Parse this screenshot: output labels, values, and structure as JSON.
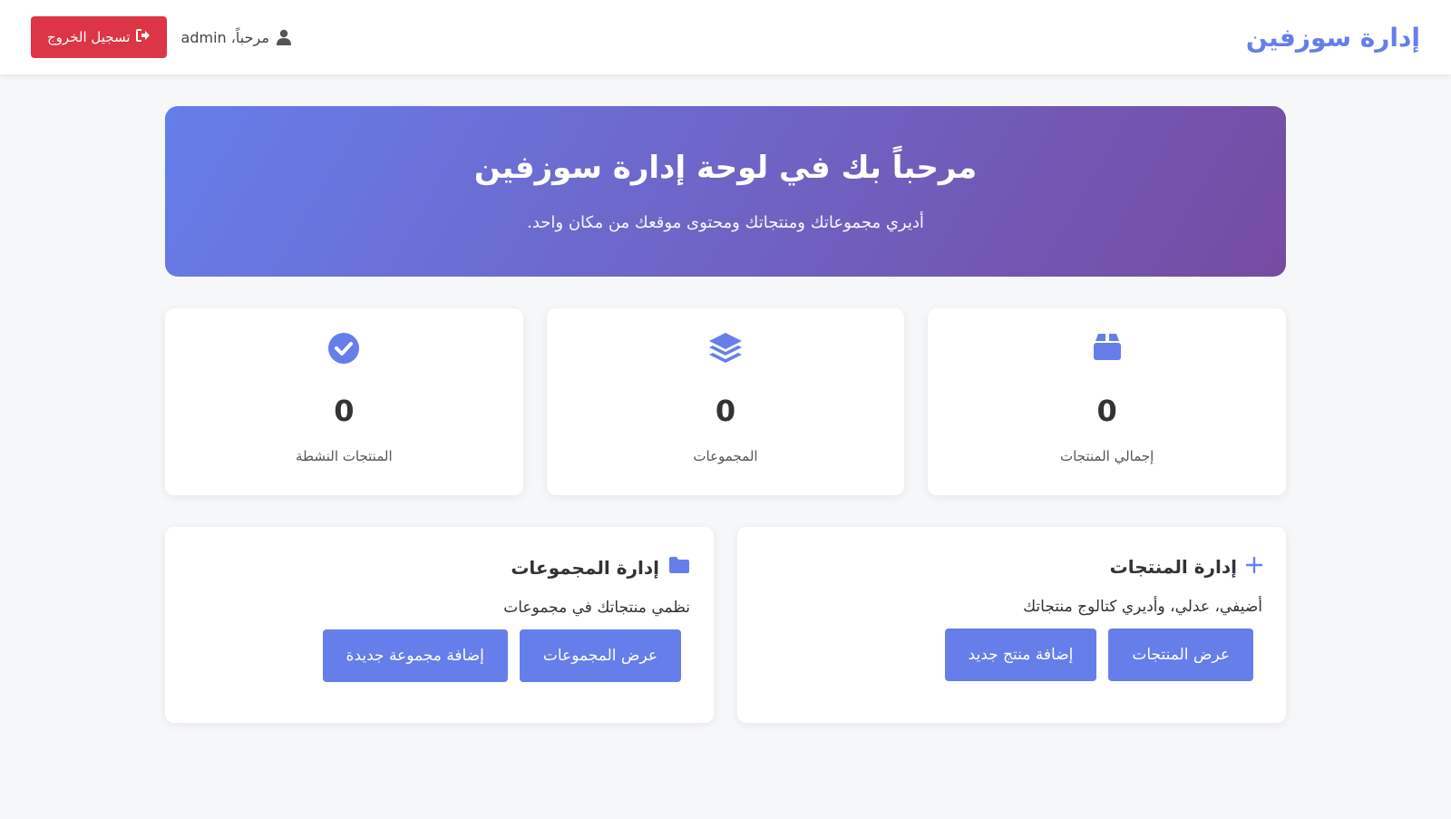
{
  "navbar": {
    "brand": "إدارة سوزفين",
    "greeting": "مرحباً، admin",
    "logout_label": "تسجيل الخروج"
  },
  "hero": {
    "title": "مرحباً بك في لوحة إدارة سوزفين",
    "subtitle": "أديري مجموعاتك ومنتجاتك ومحتوى موقعك من مكان واحد."
  },
  "stats": [
    {
      "icon": "box-icon",
      "value": "0",
      "label": "إجمالي المنتجات"
    },
    {
      "icon": "layers-icon",
      "value": "0",
      "label": "المجموعات"
    },
    {
      "icon": "check-circle-icon",
      "value": "0",
      "label": "المنتجات النشطة"
    }
  ],
  "panels": {
    "products": {
      "icon": "plus-icon",
      "title": "إدارة المنتجات",
      "description": "أضيفي، عدلي، وأديري كتالوج منتجاتك",
      "view_label": "عرض المنتجات",
      "add_label": "إضافة منتج جديد"
    },
    "collections": {
      "icon": "folder-icon",
      "title": "إدارة المجموعات",
      "description": "نظمي منتجاتك في مجموعات",
      "view_label": "عرض المجموعات",
      "add_label": "إضافة مجموعة جديدة"
    }
  },
  "colors": {
    "accent": "#667eea",
    "gradient_end": "#764ba2",
    "danger": "#dc3545",
    "background": "#f6f7f9"
  }
}
